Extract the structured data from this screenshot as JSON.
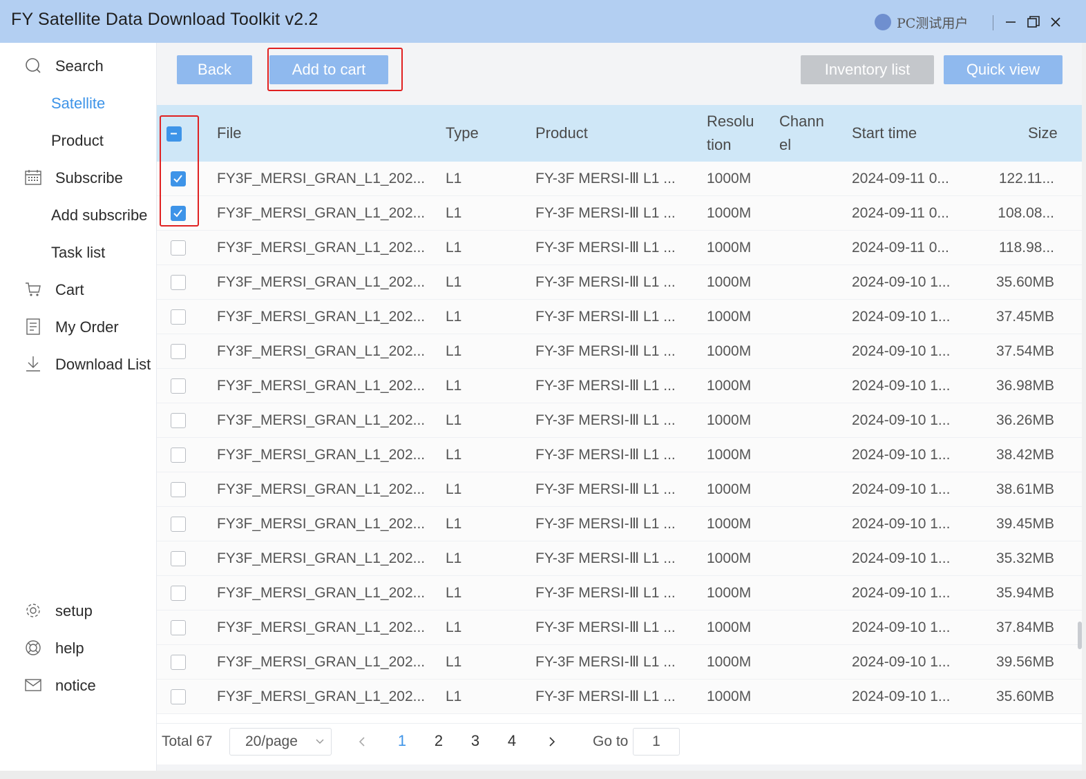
{
  "window": {
    "title": "FY Satellite Data Download Toolkit v2.2",
    "user": "PC测试用户"
  },
  "sidebar": {
    "items": [
      {
        "label": "Search",
        "icon": "search-icon"
      },
      {
        "label": "Satellite",
        "active": true
      },
      {
        "label": "Product"
      },
      {
        "label": "Subscribe",
        "icon": "calendar-icon"
      },
      {
        "label": "Add subscribe"
      },
      {
        "label": "Task list"
      },
      {
        "label": "Cart",
        "icon": "cart-icon"
      },
      {
        "label": "My Order",
        "icon": "document-icon"
      },
      {
        "label": "Download List",
        "icon": "download-icon"
      },
      {
        "label": "setup",
        "icon": "gear-icon"
      },
      {
        "label": "help",
        "icon": "lifebuoy-icon"
      },
      {
        "label": "notice",
        "icon": "mail-icon"
      }
    ]
  },
  "toolbar": {
    "back": "Back",
    "add_to_cart": "Add to cart",
    "inventory_list": "Inventory list",
    "quick_view": "Quick view"
  },
  "table": {
    "headers": {
      "file": "File",
      "type": "Type",
      "product": "Product",
      "resolution_1": "Resolu",
      "resolution_2": "tion",
      "channel_1": "Chann",
      "channel_2": "el",
      "start_time": "Start time",
      "size": "Size"
    },
    "rows": [
      {
        "file": "FY3F_MERSI_GRAN_L1_202...",
        "type": "L1",
        "product": "FY-3F MERSI-Ⅲ L1 ...",
        "resolution": "1000M",
        "channel": "",
        "start": "2024-09-11 0...",
        "size": "122.11...",
        "checked": true
      },
      {
        "file": "FY3F_MERSI_GRAN_L1_202...",
        "type": "L1",
        "product": "FY-3F MERSI-Ⅲ L1 ...",
        "resolution": "1000M",
        "channel": "",
        "start": "2024-09-11 0...",
        "size": "108.08...",
        "checked": true
      },
      {
        "file": "FY3F_MERSI_GRAN_L1_202...",
        "type": "L1",
        "product": "FY-3F MERSI-Ⅲ L1 ...",
        "resolution": "1000M",
        "channel": "",
        "start": "2024-09-11 0...",
        "size": "118.98...",
        "checked": false
      },
      {
        "file": "FY3F_MERSI_GRAN_L1_202...",
        "type": "L1",
        "product": "FY-3F MERSI-Ⅲ L1 ...",
        "resolution": "1000M",
        "channel": "",
        "start": "2024-09-10 1...",
        "size": "35.60MB",
        "checked": false
      },
      {
        "file": "FY3F_MERSI_GRAN_L1_202...",
        "type": "L1",
        "product": "FY-3F MERSI-Ⅲ L1 ...",
        "resolution": "1000M",
        "channel": "",
        "start": "2024-09-10 1...",
        "size": "37.45MB",
        "checked": false
      },
      {
        "file": "FY3F_MERSI_GRAN_L1_202...",
        "type": "L1",
        "product": "FY-3F MERSI-Ⅲ L1 ...",
        "resolution": "1000M",
        "channel": "",
        "start": "2024-09-10 1...",
        "size": "37.54MB",
        "checked": false
      },
      {
        "file": "FY3F_MERSI_GRAN_L1_202...",
        "type": "L1",
        "product": "FY-3F MERSI-Ⅲ L1 ...",
        "resolution": "1000M",
        "channel": "",
        "start": "2024-09-10 1...",
        "size": "36.98MB",
        "checked": false
      },
      {
        "file": "FY3F_MERSI_GRAN_L1_202...",
        "type": "L1",
        "product": "FY-3F MERSI-Ⅲ L1 ...",
        "resolution": "1000M",
        "channel": "",
        "start": "2024-09-10 1...",
        "size": "36.26MB",
        "checked": false
      },
      {
        "file": "FY3F_MERSI_GRAN_L1_202...",
        "type": "L1",
        "product": "FY-3F MERSI-Ⅲ L1 ...",
        "resolution": "1000M",
        "channel": "",
        "start": "2024-09-10 1...",
        "size": "38.42MB",
        "checked": false
      },
      {
        "file": "FY3F_MERSI_GRAN_L1_202...",
        "type": "L1",
        "product": "FY-3F MERSI-Ⅲ L1 ...",
        "resolution": "1000M",
        "channel": "",
        "start": "2024-09-10 1...",
        "size": "38.61MB",
        "checked": false
      },
      {
        "file": "FY3F_MERSI_GRAN_L1_202...",
        "type": "L1",
        "product": "FY-3F MERSI-Ⅲ L1 ...",
        "resolution": "1000M",
        "channel": "",
        "start": "2024-09-10 1...",
        "size": "39.45MB",
        "checked": false
      },
      {
        "file": "FY3F_MERSI_GRAN_L1_202...",
        "type": "L1",
        "product": "FY-3F MERSI-Ⅲ L1 ...",
        "resolution": "1000M",
        "channel": "",
        "start": "2024-09-10 1...",
        "size": "35.32MB",
        "checked": false
      },
      {
        "file": "FY3F_MERSI_GRAN_L1_202...",
        "type": "L1",
        "product": "FY-3F MERSI-Ⅲ L1 ...",
        "resolution": "1000M",
        "channel": "",
        "start": "2024-09-10 1...",
        "size": "35.94MB",
        "checked": false
      },
      {
        "file": "FY3F_MERSI_GRAN_L1_202...",
        "type": "L1",
        "product": "FY-3F MERSI-Ⅲ L1 ...",
        "resolution": "1000M",
        "channel": "",
        "start": "2024-09-10 1...",
        "size": "37.84MB",
        "checked": false
      },
      {
        "file": "FY3F_MERSI_GRAN_L1_202...",
        "type": "L1",
        "product": "FY-3F MERSI-Ⅲ L1 ...",
        "resolution": "1000M",
        "channel": "",
        "start": "2024-09-10 1...",
        "size": "39.56MB",
        "checked": false
      },
      {
        "file": "FY3F_MERSI_GRAN_L1_202...",
        "type": "L1",
        "product": "FY-3F MERSI-Ⅲ L1 ...",
        "resolution": "1000M",
        "channel": "",
        "start": "2024-09-10 1...",
        "size": "35.60MB",
        "checked": false
      }
    ]
  },
  "pagination": {
    "total": "Total 67",
    "page_size": "20/page",
    "pages": [
      "1",
      "2",
      "3",
      "4"
    ],
    "current": "1",
    "goto_label": "Go to",
    "goto_value": "1"
  },
  "colors": {
    "accent": "#3e94e8",
    "titlebar": "#b3cff2",
    "table_header": "#cfe7f7",
    "button_blue": "#8fb9ee",
    "button_gray": "#c4c7cb",
    "highlight_red": "#e02020"
  }
}
